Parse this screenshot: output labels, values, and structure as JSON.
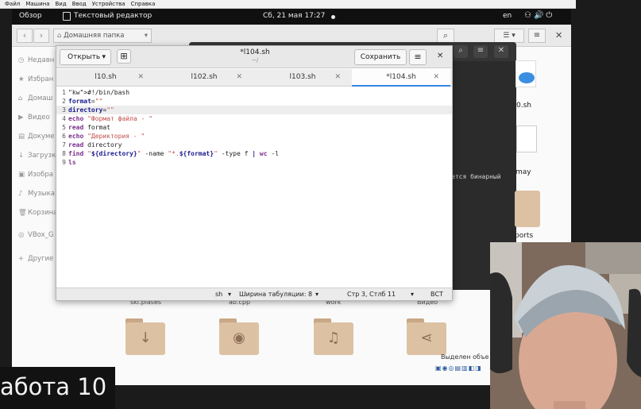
{
  "vbox_menu": [
    "Файл",
    "Машина",
    "Вид",
    "Ввод",
    "Устройства",
    "Справка"
  ],
  "topbar": {
    "activities": "Обзор",
    "app_name": "Текстовый редактор",
    "clock": "Сб, 21 мая  17:27",
    "lang": "en",
    "system_icons": "network-icon volume-icon power-icon"
  },
  "files": {
    "path": "Домашняя папка",
    "sidebar": [
      {
        "icon": "clock-icon",
        "label": "Недавн"
      },
      {
        "icon": "star-icon",
        "label": "Избран"
      },
      {
        "icon": "home-icon",
        "label": "Домаш"
      },
      {
        "icon": "video-icon",
        "label": "Видео"
      },
      {
        "icon": "document-icon",
        "label": "Докуме"
      },
      {
        "icon": "download-icon",
        "label": "Загрузк"
      },
      {
        "icon": "image-icon",
        "label": "Изобра"
      },
      {
        "icon": "music-icon",
        "label": "Музыка"
      },
      {
        "icon": "trash-icon",
        "label": "Корзина"
      },
      {
        "icon": "drive-icon",
        "label": "VBox_G"
      },
      {
        "icon": "plus-icon",
        "label": "Другие"
      }
    ],
    "folders": [
      {
        "label": "ski.plases",
        "icon": "download-icon"
      },
      {
        "label": "ab.cpp",
        "icon": "camera-icon"
      },
      {
        "label": "work",
        "icon": "music-icon"
      },
      {
        "label": "Видео",
        "icon": "share-icon"
      }
    ],
    "desktop_items": [
      {
        "label": "0.sh"
      },
      {
        "label": "may"
      },
      {
        "label": "ports"
      }
    ],
    "status": "Выделен объе"
  },
  "terminal": {
    "visible_text": "ется бинарный"
  },
  "editor": {
    "open_label": "Открыть",
    "title": "*l104.sh",
    "subtitle": "~/",
    "save_label": "Сохранить",
    "tabs": [
      {
        "label": "l10.sh",
        "active": false
      },
      {
        "label": "l102.sh",
        "active": false
      },
      {
        "label": "l103.sh",
        "active": false
      },
      {
        "label": "*l104.sh",
        "active": true
      }
    ],
    "lines": [
      {
        "n": "1",
        "text": "#!/bin/bash"
      },
      {
        "n": "2",
        "text": "format=\"\""
      },
      {
        "n": "3",
        "text": "directory=\"\""
      },
      {
        "n": "4",
        "text": "echo \"Формат файла - \""
      },
      {
        "n": "5",
        "text": "read format"
      },
      {
        "n": "6",
        "text": "echo \"Дериктория - \""
      },
      {
        "n": "7",
        "text": "read directory"
      },
      {
        "n": "8",
        "text": "find \"${directory}\" -name \"*.${format}\" -type f | wc -l"
      },
      {
        "n": "9",
        "text": "ls"
      }
    ],
    "status": {
      "lang": "sh",
      "tab_width": "Ширина табуляции: 8",
      "position": "Стр 3, Стлб 11",
      "mode": "ВСТ"
    }
  },
  "caption": "абота 10",
  "colors": {
    "accent": "#3584e4",
    "keyword": "#7b2e8c",
    "string": "#c0504d",
    "variable": "#1a1a8e"
  }
}
